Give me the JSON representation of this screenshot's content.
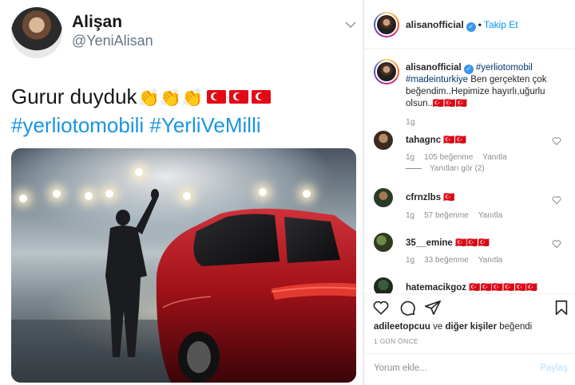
{
  "tweet": {
    "name": "Alişan",
    "handle": "@YeniAlisan",
    "text": "Gurur duyduk",
    "emojis": "👏👏👏",
    "hashtags": "#yerliotomobili #YerliVeMilli"
  },
  "instagram": {
    "header": {
      "username": "alisanofficial",
      "separator": "•",
      "follow_label": "Takip Et"
    },
    "caption": {
      "username": "alisanofficial",
      "tag1": "#yerliotomobil",
      "tag2": "#madeinturkiye",
      "text": "Ben gerçekten çok beğendim..Hepimize hayırlı,uğurlu olsun..🇹🇷🇹🇷🇹🇷",
      "time": "1g"
    },
    "comments": [
      {
        "username": "tahagnc",
        "text": "🇹🇷🇹🇷",
        "time": "1g",
        "likes": "105 beğenme",
        "reply": "Yanıtla",
        "view_replies": "Yanıtları gör (2)"
      },
      {
        "username": "cfrnzlbs",
        "text": "🇹🇷",
        "time": "1g",
        "likes": "57 beğenme",
        "reply": "Yanıtla"
      },
      {
        "username": "35__emine",
        "text": "🇹🇷🇹🇷🇹🇷",
        "time": "1g",
        "likes": "33 beğenme",
        "reply": "Yanıtla"
      },
      {
        "username": "hatemacikgoz",
        "text": "🇹🇷🇹🇷🇹🇷🇹🇷🇹🇷🇹🇷"
      }
    ],
    "liked_by": {
      "user": "adileetopcuu",
      "connector": "ve",
      "others": "diğer kişiler",
      "suffix": "beğendi"
    },
    "time_ago": "1 GÜN ÖNCE",
    "comment_placeholder": "Yorum ekle...",
    "post_label": "Paylaş"
  },
  "colors": {
    "twitter_blue": "#1b95e0",
    "instagram_blue": "#0095f6",
    "flag_red": "#e30a17",
    "car_red": "#b3141c"
  }
}
